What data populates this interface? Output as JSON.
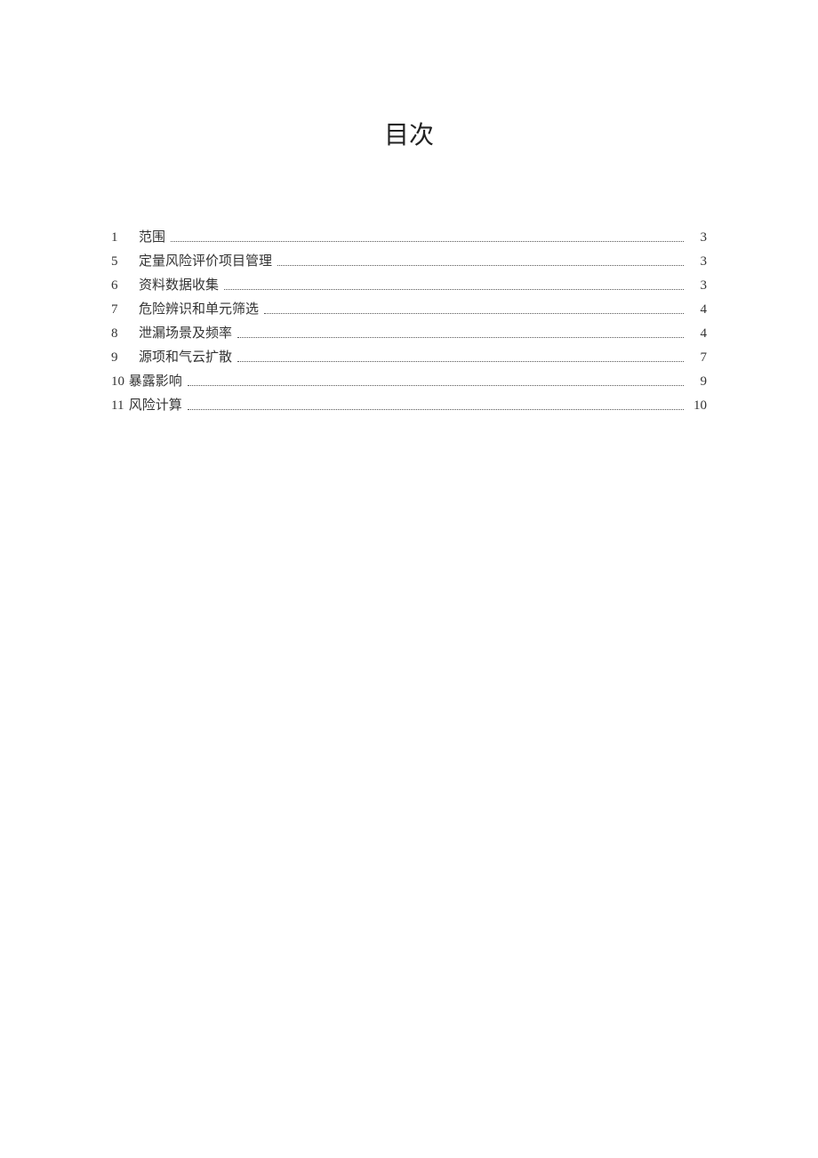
{
  "title": "目次",
  "toc": [
    {
      "num": "1",
      "gap": "    ",
      "text": "范围",
      "page": "3"
    },
    {
      "num": "5",
      "gap": "    ",
      "text": "定量风险评价项目管理",
      "page": "3"
    },
    {
      "num": "6",
      "gap": "    ",
      "text": "资料数据收集",
      "page": "3"
    },
    {
      "num": "7",
      "gap": "    ",
      "text": "危险辨识和单元筛选",
      "page": "4"
    },
    {
      "num": "8",
      "gap": "    ",
      "text": "泄漏场景及频率",
      "page": "4"
    },
    {
      "num": "9",
      "gap": "    ",
      "text": "源项和气云扩散",
      "page": "7"
    },
    {
      "num": "10",
      "gap": " ",
      "text": "暴露影响",
      "page": "9"
    },
    {
      "num": "11",
      "gap": " ",
      "text": "风险计算",
      "page": "10"
    }
  ]
}
